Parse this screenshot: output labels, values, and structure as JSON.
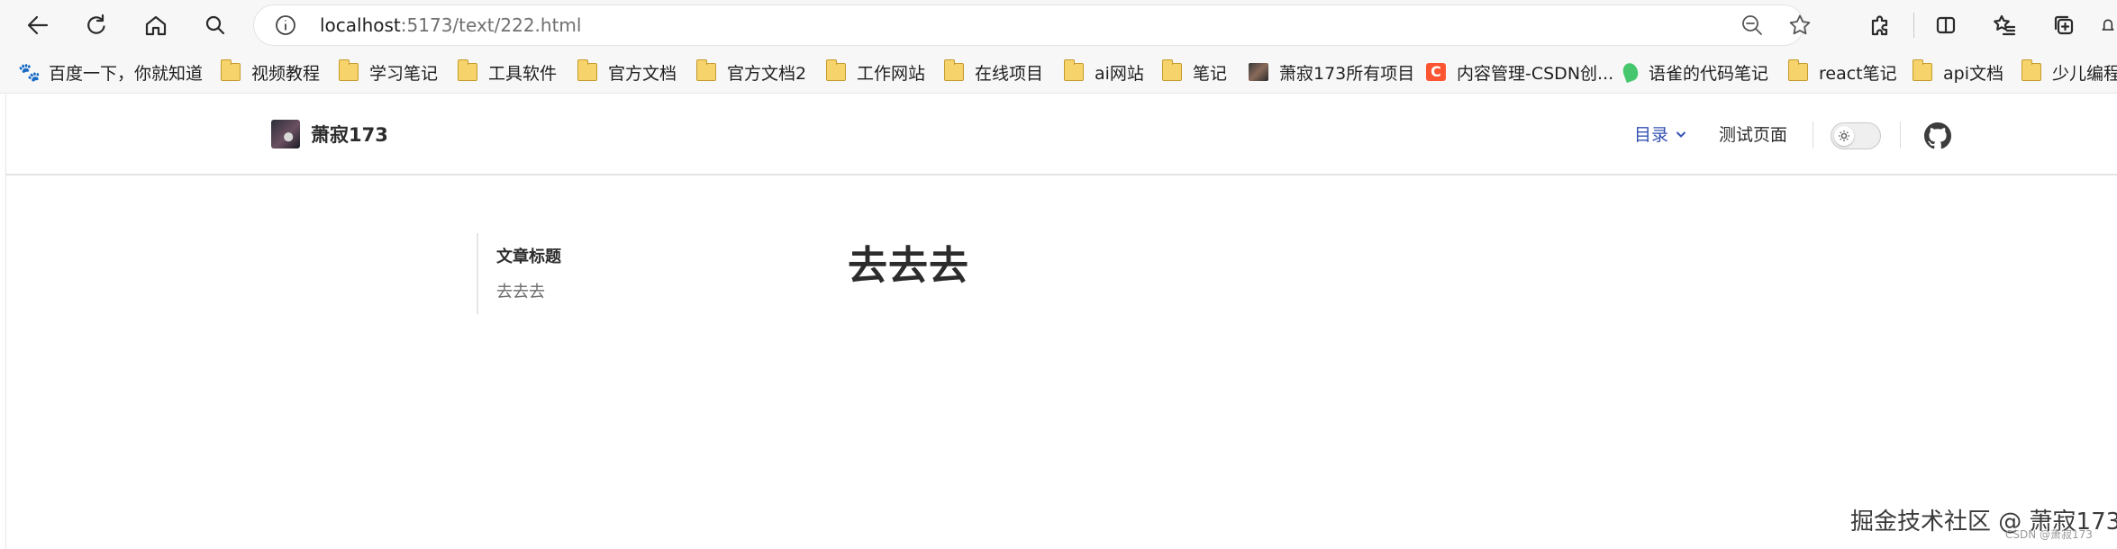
{
  "browser": {
    "url_host": "localhost",
    "url_rest": ":5173/text/222.html"
  },
  "bookmarks": [
    {
      "label": "百度一下，你就知道",
      "icon": "baidu-paw-icon"
    },
    {
      "label": "视频教程",
      "icon": "folder-icon"
    },
    {
      "label": "学习笔记",
      "icon": "folder-icon"
    },
    {
      "label": "工具软件",
      "icon": "folder-icon"
    },
    {
      "label": "官方文档",
      "icon": "folder-icon"
    },
    {
      "label": "官方文档2",
      "icon": "folder-icon"
    },
    {
      "label": "工作网站",
      "icon": "folder-icon"
    },
    {
      "label": "在线项目",
      "icon": "folder-icon"
    },
    {
      "label": "ai网站",
      "icon": "folder-icon"
    },
    {
      "label": "笔记",
      "icon": "folder-icon"
    },
    {
      "label": "萧寂173所有项目",
      "icon": "avatar-thumbnail-icon"
    },
    {
      "label": "内容管理-CSDN创...",
      "icon": "csdn-icon"
    },
    {
      "label": "语雀的代码笔记",
      "icon": "yuque-leaf-icon"
    },
    {
      "label": "react笔记",
      "icon": "folder-icon"
    },
    {
      "label": "api文档",
      "icon": "folder-icon"
    },
    {
      "label": "少儿编程",
      "icon": "folder-icon"
    }
  ],
  "site": {
    "brand": "萧寂173",
    "nav_toc": "目录",
    "nav_test": "测试页面"
  },
  "aside": {
    "title": "文章标题",
    "item": "去去去"
  },
  "article": {
    "title": "去去去"
  },
  "watermark": {
    "main": "掘金技术社区 @ 萧寂173",
    "small": "CSDN @萧寂173"
  },
  "colors": {
    "brand_link": "#3451b2",
    "folder": "#f7d36b",
    "csdn": "#fc5531"
  }
}
